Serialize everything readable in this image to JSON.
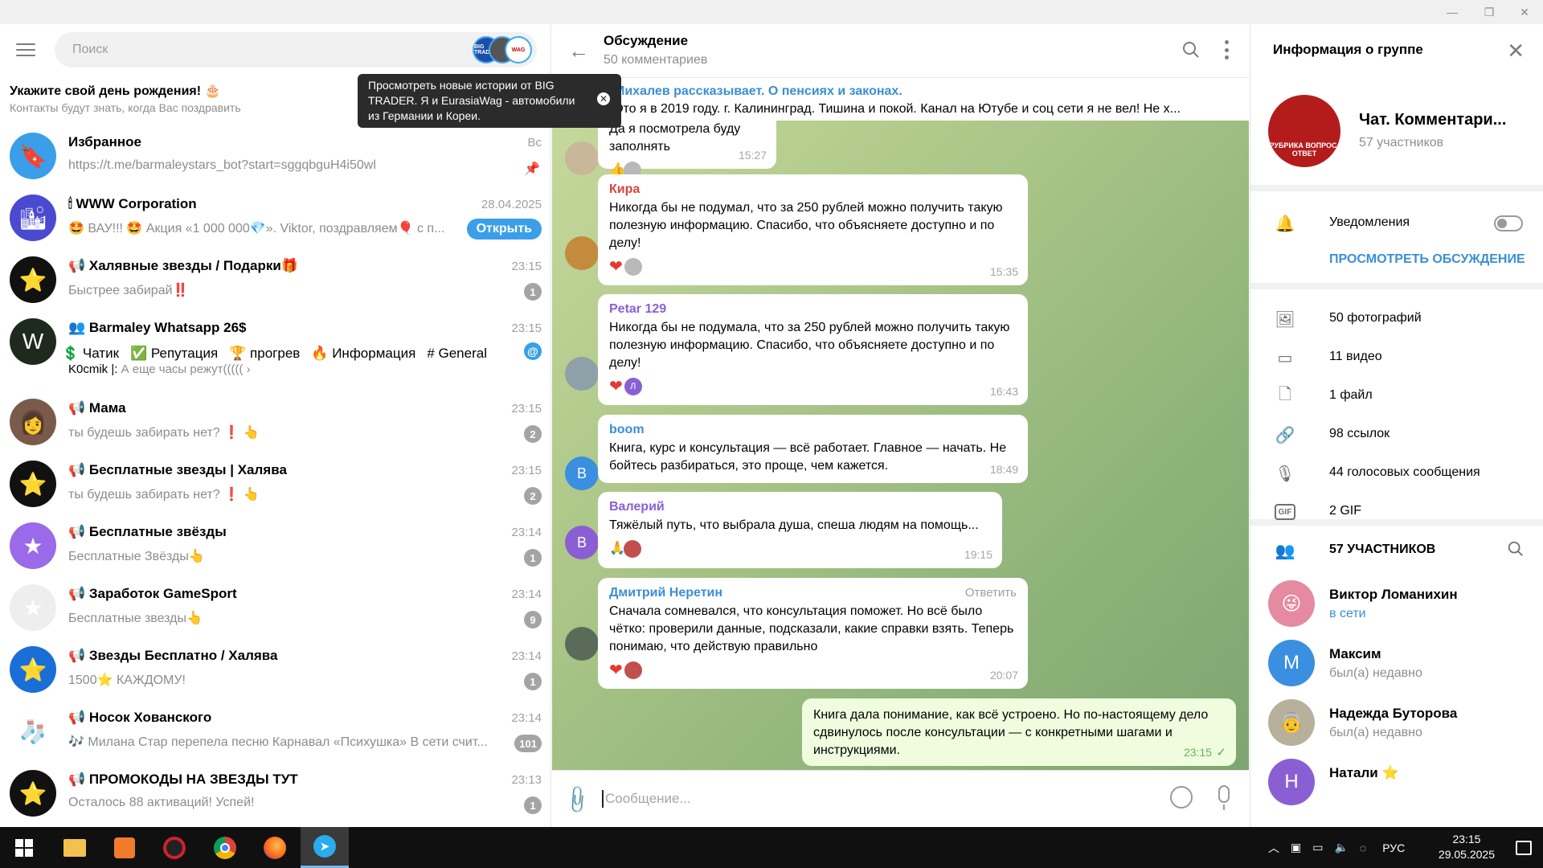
{
  "window": {
    "minimize": "—",
    "restore": "❐",
    "close": "✕"
  },
  "left": {
    "search_placeholder": "Поиск",
    "birthday_title": "Укажите свой день рождения! 🎂",
    "birthday_sub": "Контакты будут знать, когда Вас поздравить",
    "tooltip": "Просмотреть новые истории от BIG TRADER. Я и EurasiaWag - автомобили из Германии и Кореи.",
    "tooltip_close": "✕",
    "story_labels": [
      "BIG TRADER",
      "",
      "WAG"
    ],
    "chats": [
      {
        "name": "Избранное",
        "time": "Вс",
        "preview": "https://t.me/barmaleystars_bot?start=sggqbguH4i50wl",
        "pinned": "📌",
        "color": "#3a9fe8",
        "avatar_glyph": "🔖"
      },
      {
        "name": "🕯 WWW Corporation",
        "time": "28.04.2025",
        "preview": "🤩 ВАУ!!! 🤩 Акция «1 000 000💎». Viktor, поздравляем🎈 с п...",
        "open": "Открыть",
        "color": "#4a4ad0",
        "avatar_glyph": "🏙"
      },
      {
        "name": "📢 Халявные звезды / Подарки🎁",
        "time": "23:15",
        "preview": "Быстрее забирай‼️",
        "badge": "1",
        "color": "#111111",
        "avatar_glyph": "⭐"
      },
      {
        "name": "👥 Barmaley Whatsapp 26$",
        "time": "23:15",
        "topics": [
          "💲 Чатик",
          "✅ Репутация",
          "🏆 прогрев",
          "🔥 Информация",
          "# General"
        ],
        "sub_author": "K0cmik |:",
        "sub_text": " А еще часы режут((((( ›",
        "color": "#1f2a1f",
        "avatar_glyph": "W"
      },
      {
        "name": "📢 Мама",
        "time": "23:15",
        "preview": "ты будешь забирать нет? ❗ 👆",
        "badge": "2",
        "color": "#7a5a4a",
        "avatar_glyph": "👩"
      },
      {
        "name": "📢 Бесплатные звезды | Халява",
        "time": "23:15",
        "preview": "ты будешь забирать нет? ❗ 👆",
        "badge": "2",
        "color": "#111111",
        "avatar_glyph": "⭐"
      },
      {
        "name": "📢 Бесплатные звёзды",
        "time": "23:14",
        "preview": "Бесплатные Звёзды👆",
        "badge": "1",
        "color": "#9a6ae8",
        "avatar_glyph": "★"
      },
      {
        "name": "📢 Заработок GameSport",
        "time": "23:14",
        "preview": "Бесплатные звезды👆",
        "badge": "9",
        "color": "#eeeeee",
        "avatar_glyph": "★"
      },
      {
        "name": "📢 Звезды Бесплатно / Халява",
        "time": "23:14",
        "preview": "1500⭐ КАЖДОМУ!",
        "badge": "1",
        "color": "#1a6ed8",
        "avatar_glyph": "⭐"
      },
      {
        "name": "📢 Носок Хованского",
        "time": "23:14",
        "preview": "🎶 Милана Стар перепела песню Карнавал «Психушка»  В сети счит...",
        "badge": "101",
        "color": "#ffffff",
        "avatar_glyph": "🧦"
      },
      {
        "name": "📢 ПРОМОКОДЫ НА ЗВЕЗДЫ ТУТ",
        "time": "23:13",
        "preview": "Осталось 88 активаций! Успей!",
        "badge": "1",
        "color": "#111111",
        "avatar_glyph": "⭐"
      }
    ],
    "at_badge": "@"
  },
  "chat": {
    "title": "Обсуждение",
    "subtitle": "50 комментариев",
    "back": "←",
    "pinned_title": "Михалев рассказывает. О пенсиях и законах.",
    "pinned_preview": "Это я в 2019 году.  г. Калининград.   Тишина и покой.  Канал на Ютубе и соц сети я не вел! Не х...",
    "messages": [
      {
        "author": "",
        "text": "Да я посмотрела буду заполнять",
        "time": "15:27",
        "react": "👍"
      },
      {
        "author": "Кира",
        "author_color": "#d9443e",
        "text": "Никогда бы не подумал, что за 250 рублей можно получить такую полезную информацию. Спасибо, что объясняете доступно и по делу!",
        "time": "15:35",
        "react": "❤"
      },
      {
        "author": "Petar 129",
        "author_color": "#8b5fd4",
        "text": "Никогда бы не подумала, что за 250 рублей можно получить такую полезную информацию. Спасибо, что объясняете доступно и по делу!",
        "time": "16:43",
        "react": "❤",
        "react2": "Л"
      },
      {
        "author": "boom",
        "author_color": "#3a8fd4",
        "text": "Книга, курс и консультация — всё работает. Главное — начать. Не бойтесь разбираться, это проще, чем кажется.",
        "time": "18:49",
        "avatar_letter": "B"
      },
      {
        "author": "Валерий",
        "author_color": "#8b5fd4",
        "text": "Тяжёлый путь, что выбрала душа, спеша людям на помощь...",
        "time": "19:15",
        "react": "🙏",
        "avatar_letter": "В"
      },
      {
        "author": "Дмитрий Неретин",
        "author_color": "#3a8fd4",
        "reply": "Ответить",
        "text": "Сначала сомневался, что консультация поможет. Но всё было чётко: проверили данные, подсказали, какие справки взять. Теперь понимаю, что действую правильно",
        "time": "20:07",
        "react": "❤"
      }
    ],
    "outgoing": {
      "text": "Книга дала понимание, как всё устроено. Но по-настоящему дело сдвинулось после консультации — с конкретными шагами и инструкциями.",
      "time": "23:15",
      "check": "✓"
    },
    "composer_placeholder": "Сообщение..."
  },
  "info": {
    "title": "Информация о группе",
    "close": "✕",
    "group_name": "Чат. Комментари...",
    "group_count": "57 участников",
    "avatar_caption": "РУБРИКА ВОПРОС-ОТВЕТ",
    "notifications": "Уведомления",
    "view_discussion": "ПРОСМОТРЕТЬ ОБСУЖДЕНИЕ",
    "media": [
      {
        "icon": "photo-icon",
        "glyph": "🖼",
        "label": "50 фотографий"
      },
      {
        "icon": "video-icon",
        "glyph": "▭",
        "label": "11 видео"
      },
      {
        "icon": "file-icon",
        "glyph": "🗋",
        "label": "1 файл"
      },
      {
        "icon": "link-icon",
        "glyph": "🔗",
        "label": "98 ссылок"
      },
      {
        "icon": "mic-icon",
        "glyph": "🎙",
        "label": "44 голосовых сообщения"
      },
      {
        "icon": "gif-icon",
        "glyph": "GIF",
        "label": "2 GIF"
      }
    ],
    "members_header": "57 УЧАСТНИКОВ",
    "members": [
      {
        "name": "Виктор Ломанихин",
        "status": "в сети",
        "online": true,
        "color": "#e58aa0",
        "letter": "😜"
      },
      {
        "name": "Максим",
        "status": "был(а) недавно",
        "online": false,
        "color": "#3a8fe0",
        "letter": "М"
      },
      {
        "name": "Надежда Буторова",
        "status": "был(а) недавно",
        "online": false,
        "color": "#b7b09a",
        "letter": "👵"
      },
      {
        "name": "Натали ⭐",
        "status": "",
        "online": false,
        "color": "#8b5fd4",
        "letter": "Н"
      }
    ]
  },
  "taskbar": {
    "lang": "РУС",
    "time": "23:15",
    "date": "29.05.2025"
  }
}
